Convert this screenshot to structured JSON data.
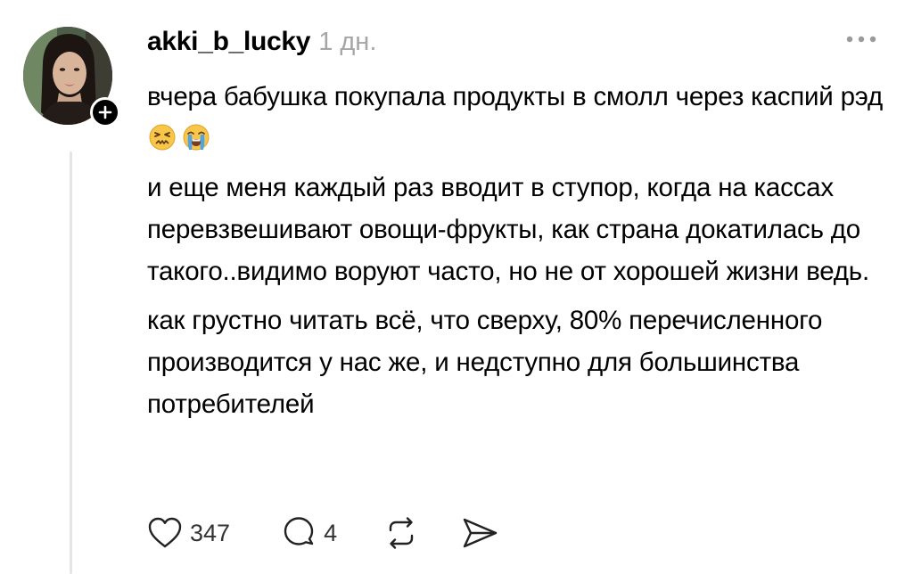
{
  "post": {
    "author": {
      "username": "akki_b_lucky",
      "avatar_icon": "avatar-photo",
      "follow_icon": "plus-icon"
    },
    "timestamp": "1 дн.",
    "more_icon": "more-horizontal-icon",
    "body": {
      "paragraphs": [
        {
          "text": "вчера бабушка покупала продукты в смолл через каспий рэд",
          "emojis": [
            "confounded-face-emoji",
            "loudly-crying-face-emoji"
          ]
        },
        {
          "text": "и еще меня каждый раз вводит в ступор, когда на кассах перевзвешивают овощи-фрукты, как страна докатилась до такого..видимо воруют часто, но не от хорошей жизни ведь."
        },
        {
          "text": "как грустно читать всё, что сверху, 80% перечисленного производится у нас же, и недступно для большинства потребителей"
        }
      ]
    },
    "actions": {
      "like": {
        "icon": "heart-icon",
        "count": "347"
      },
      "reply": {
        "icon": "comment-icon",
        "count": "4"
      },
      "repost": {
        "icon": "repost-icon"
      },
      "share": {
        "icon": "send-icon"
      }
    }
  },
  "colors": {
    "text": "#000000",
    "muted": "#a6a6a6",
    "thread_line": "#e5e5e5",
    "badge": "#000000"
  }
}
